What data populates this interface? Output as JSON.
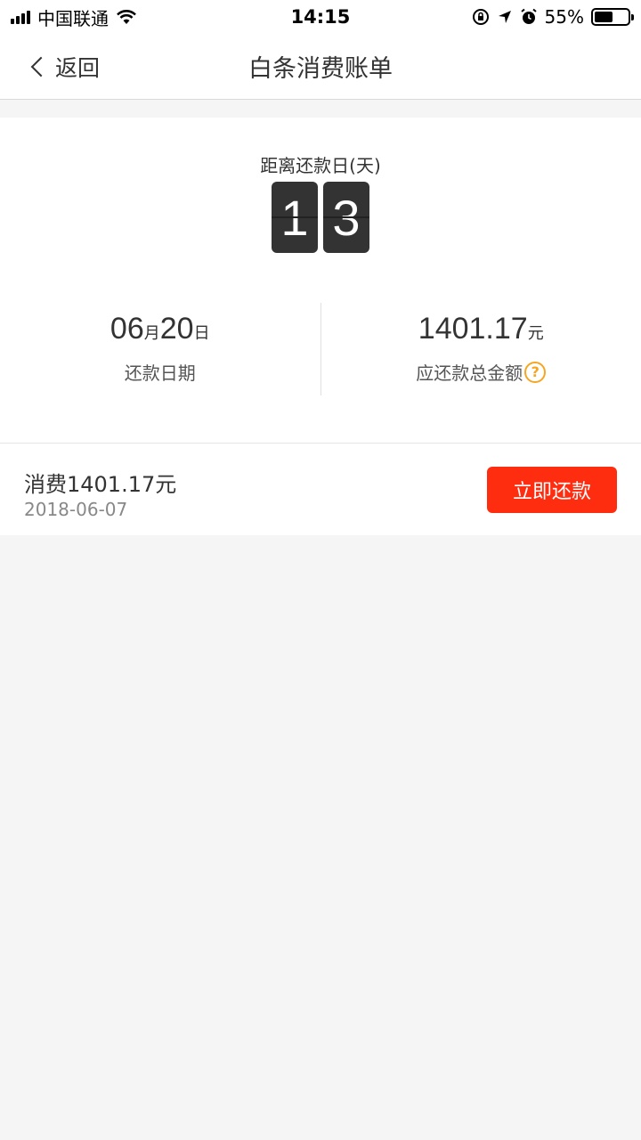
{
  "status_bar": {
    "carrier": "中国联通",
    "time": "14:15",
    "battery_percent": "55%",
    "battery_level": 0.55,
    "icons": [
      "signal-icon",
      "wifi-icon",
      "rotation-lock-icon",
      "location-icon",
      "alarm-icon",
      "battery-icon"
    ]
  },
  "nav": {
    "back_label": "返回",
    "title": "白条消费账单"
  },
  "summary": {
    "countdown_label": "距离还款日(天)",
    "countdown_digits": [
      "1",
      "3"
    ],
    "due_date": {
      "month": "06",
      "month_unit": "月",
      "day": "20",
      "day_unit": "日",
      "label": "还款日期"
    },
    "total": {
      "amount": "1401.17",
      "unit": "元",
      "label": "应还款总金额",
      "help": "?"
    }
  },
  "bill": {
    "description": "消费1401.17元",
    "date": "2018-06-07",
    "pay_button": "立即还款"
  },
  "colors": {
    "accent": "#ff2d0f",
    "help": "#f5a623",
    "digit_bg": "#333333"
  }
}
